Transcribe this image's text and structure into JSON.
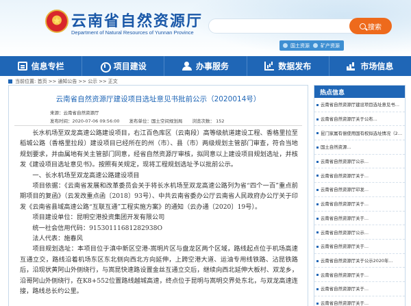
{
  "header": {
    "site_title": "云南省自然资源厅",
    "site_subtitle": "Department of Natural Resources of Yunnan Province",
    "emblem_glyph": "★",
    "quick_links": [
      "国土资源",
      "矿产资源"
    ]
  },
  "search": {
    "placeholder": "",
    "button_label": "搜索"
  },
  "nav": [
    {
      "label": "信息专栏",
      "icon": "document-icon"
    },
    {
      "label": "项目建设",
      "icon": "building-icon"
    },
    {
      "label": "办事服务",
      "icon": "person-icon"
    },
    {
      "label": "数据发布",
      "icon": "bar-chart-icon"
    },
    {
      "label": "市场信息",
      "icon": "market-chart-icon"
    }
  ],
  "breadcrumb": [
    "当前位置: 首页",
    ">>",
    "通知公告",
    ">>",
    "公示",
    ">>",
    "正文"
  ],
  "article": {
    "title": "云南省自然资源厅建设项目选址意见书批前公示（2020014号）",
    "source": "来源：云南省自然资源厅",
    "date": "发布时间：2020-07-06 09:56:00",
    "publisher": "发布单位：国土空间规划局",
    "views": "浏览次数：    152",
    "paragraphs": [
      "长水机场至双龙高速公路建设项目，右江百色库区（云南段）高等级航道建设工程、香格里拉至稻城公路（香格里拉段）建设项目已经所在的州（市）、县（市）两级规划主管部门审查，符合当地规划要求，并由属地有关主管部门同意，经省自然资源厅审核，拟同意以上建设项目规划选址，并核发《建设项目选址意见书》。按照有关规定，现将工程规划选址予以批前公示。",
      "一、长水机场至双龙高速公路建设项目",
      "项目依据：《云南省发展和改革委员会关于将长水机场至双龙高速公路列为省“四个一百”重点前期项目的复函》（云发改重点函〔2018〕93号）、中共云南省委办公厅云南省人民政府办公厅关于印发《云南省县域高速公路“互联互通”工程实施方案》的通知（云办通〔2020〕19号）。",
      "项目建设单位：昆明空港投资集团开发有限公司",
      "统一社会信用代码：91530111681282938O",
      "法人代表：施春风",
      "项目规划选址：本项目位于滇中新区空港-嵩明片区与盘龙区两个区域，路线起点位于机场高速互通立交，路线沿着机场东区东北侧向西北方向延伸，上跨空港大道、运油专用线铁路、沾昆铁路后，沿现状黄阿山外侧绕行，与嵩昆快速路设置金丝互通立交后，继续向西北延伸大板村、双龙乡，沿哥阿山外侧绕行，在K8+552位置路线越城高速，终点位于昆明与嵩明交界处东北，与双龙高速连接，路线总长约公里。"
    ]
  },
  "sidebar": {
    "heading": "热点信息",
    "items": [
      "云南省自然资源厅建设项目选址意见书批前公",
      "云南省自然资源厅关于公布...",
      "昆门家属有偿使用国有权拟选址情况（2020...",
      "国土自然资源...",
      "云南省自然资源厅公示...",
      "云南省自然资源厅关于...",
      "云南省自然资源厅印发...",
      "云南省自然资源厅关于...",
      "云南省自然资源厅关于...",
      "云南省自然资源厅公示...",
      "云南省自然资源厅关于...",
      "云南省自然资源厅关于公示2020年...",
      "云南省自然资源厅关于...",
      "云南省自然资源厅关于...",
      "云南省自然资源厅关于..."
    ]
  },
  "colors": {
    "brand_blue": "#1f66b6",
    "accent_orange": "#ee6a1c"
  }
}
